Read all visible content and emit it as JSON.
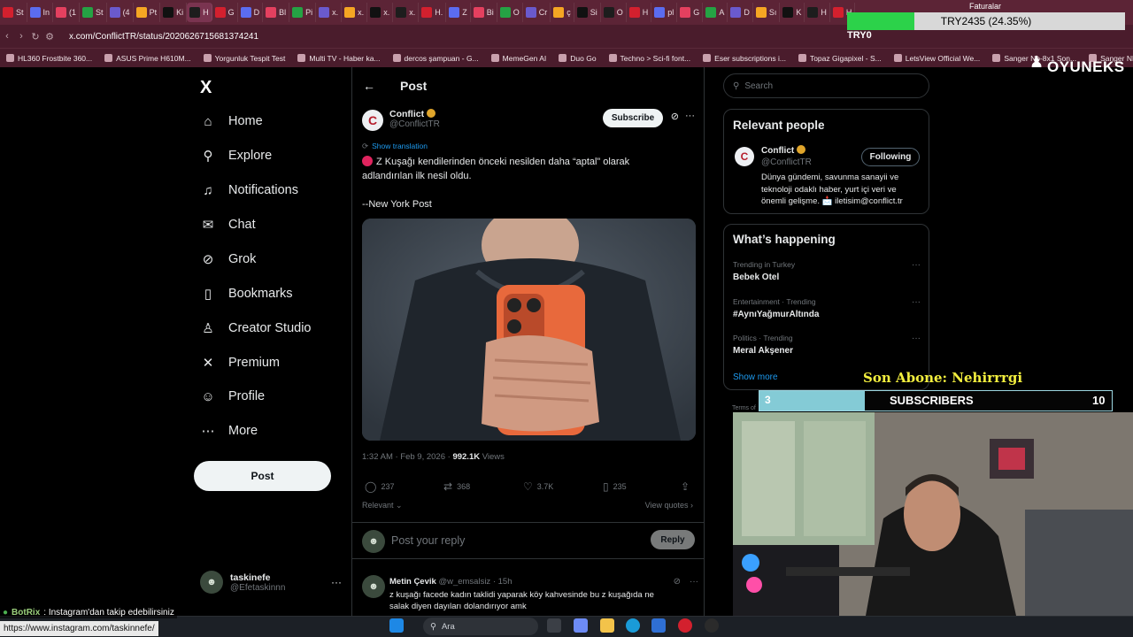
{
  "browser": {
    "tabs": [
      "St",
      "In",
      "(1",
      "St",
      "(4",
      "Pt",
      "Ki",
      "H",
      "G",
      "D",
      "Bl",
      "Pi",
      "x.",
      "x.",
      "x.",
      "x.",
      "H.",
      "Z",
      "Bi",
      "O",
      "Cr",
      "ç",
      "Si",
      "O",
      "H",
      "pl",
      "G",
      "A",
      "D",
      "Sı",
      "K",
      "H",
      "H"
    ],
    "active_tab_index": 7,
    "url": "x.com/ConflictTR/status/2020626715681374241",
    "bookmarks": [
      "HL360 Frostbite 360...",
      "ASUS Prime H610M...",
      "Yorgunluk Tespit Test",
      "Multi TV - Haber ka...",
      "dercos şampuan - G...",
      "MemeGen AI",
      "Duo Go",
      "Techno > Sci-fi font...",
      "Eser subscriptions i...",
      "Topaz Gigapixel - S...",
      "LetsView Official We...",
      "Sanger Np-8x1 Son...",
      "Sanger NP-8X1 Son..."
    ]
  },
  "left_nav": {
    "logo": "X",
    "items": [
      {
        "label": "Home",
        "icon": "home-icon",
        "glyph": "⌂"
      },
      {
        "label": "Explore",
        "icon": "search-icon",
        "glyph": "⚲"
      },
      {
        "label": "Notifications",
        "icon": "bell-icon",
        "glyph": "♫"
      },
      {
        "label": "Chat",
        "icon": "mail-icon",
        "glyph": "✉"
      },
      {
        "label": "Grok",
        "icon": "grok-icon",
        "glyph": "⊘"
      },
      {
        "label": "Bookmarks",
        "icon": "bookmark-icon",
        "glyph": "▯"
      },
      {
        "label": "Creator Studio",
        "icon": "creator-icon",
        "glyph": "♙"
      },
      {
        "label": "Premium",
        "icon": "x-icon",
        "glyph": "✕"
      },
      {
        "label": "Profile",
        "icon": "person-icon",
        "glyph": "☺"
      },
      {
        "label": "More",
        "icon": "more-icon",
        "glyph": "⋯"
      }
    ],
    "post_button": "Post",
    "account": {
      "name": "taskinefe",
      "handle": "@Efetaskinnn",
      "menu": "···"
    }
  },
  "post": {
    "header_title": "Post",
    "author_name": "Conflict",
    "author_handle": "@ConflictTR",
    "subscribe": "Subscribe",
    "show_translation": "Show translation",
    "text_line1": "Z Kuşağı kendilerinden önceki nesilden daha “aptal” olarak",
    "text_line2": "adlandırılan ilk nesil oldu.",
    "source": "--New York Post",
    "timestamp": "1:32 AM · Feb 9, 2026 ·",
    "views_count": "992.1K",
    "views_label": "Views",
    "replies": "237",
    "reposts": "368",
    "likes": "3.7K",
    "bookmarks": "235",
    "sort": "Relevant",
    "view_quotes": "View quotes",
    "reply_placeholder": "Post your reply",
    "reply_button": "Reply",
    "comment": {
      "name": "Metin Çevik",
      "handle": "@w_emsalsiz",
      "time": "· 15h",
      "text": "z kuşağı facede  kadın taklidi yaparak köy kahvesinde bu z kuşağıda ne",
      "text2": "salak diyen dayıları dolandırıyor amk"
    }
  },
  "right": {
    "search_placeholder": "Search",
    "relevant_title": "Relevant people",
    "person": {
      "name": "Conflict",
      "handle": "@ConflictTR",
      "button": "Following",
      "bio1": "Dünya gündemi, savunma sanayii ve",
      "bio2": "teknoloji odaklı haber, yurt içi veri ve",
      "bio3": "önemli gelişme. 📩 iletisim@conflict.tr"
    },
    "happening_title": "What’s happening",
    "trends": [
      {
        "category": "Trending in Turkey",
        "name": "Bebek Otel"
      },
      {
        "category": "Entertainment · Trending",
        "name": "#AynıYağmurAltında"
      },
      {
        "category": "Politics · Trending",
        "name": "Meral Akşener"
      }
    ],
    "show_more": "Show more",
    "terms": "Terms of"
  },
  "overlays": {
    "faturalar": "Faturalar",
    "price": "TRY2435 (24.35%)",
    "price_fraction": 0.2435,
    "try_label": "TRY0",
    "brand": "OYUNEKS",
    "son_abone": "Son Abone: Nehirrrgi",
    "subs_current": "3",
    "subs_title": "SUBSCRIBERS",
    "subs_goal": "10",
    "botrix": "BotRix",
    "botrix_msg": ": Instagram'dan takip edebilirsiniz",
    "status_url": "https://www.instagram.com/taskinnefe/",
    "win_search": "Ara"
  },
  "colors": {
    "accent_green": "#2cd24a",
    "subs_fill": "#84cbd6",
    "son_abone": "#f2ee3e",
    "verified": "#e0a52b"
  }
}
